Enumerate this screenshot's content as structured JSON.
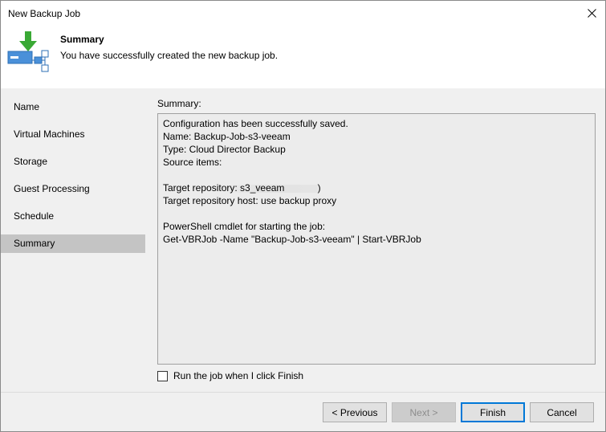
{
  "window": {
    "title": "New Backup Job"
  },
  "header": {
    "title": "Summary",
    "subtitle": "You have successfully created the new backup job.",
    "icon": "backup-job-icon"
  },
  "sidebar": {
    "items": [
      {
        "label": "Name"
      },
      {
        "label": "Virtual Machines"
      },
      {
        "label": "Storage"
      },
      {
        "label": "Guest Processing"
      },
      {
        "label": "Schedule"
      },
      {
        "label": "Summary",
        "active": true
      }
    ]
  },
  "summary": {
    "label": "Summary:",
    "lines": [
      "Configuration has been successfully saved.",
      "Name: Backup-Job-s3-veeam",
      "Type: Cloud Director Backup",
      "Source items:",
      "",
      "Target repository: s3_veeam",
      "Target repository host: use backup proxy",
      "",
      "PowerShell cmdlet for starting the job:",
      "Get-VBRJob -Name \"Backup-Job-s3-veeam\" | Start-VBRJob"
    ],
    "redacted_item_suffix": ")"
  },
  "run_on_finish": {
    "label": "Run the job when I click Finish",
    "checked": false
  },
  "buttons": {
    "previous": "< Previous",
    "next": "Next >",
    "finish": "Finish",
    "cancel": "Cancel"
  },
  "colors": {
    "accent": "#0078d7",
    "icon_green": "#3aa935",
    "icon_blue": "#4a90d9"
  }
}
